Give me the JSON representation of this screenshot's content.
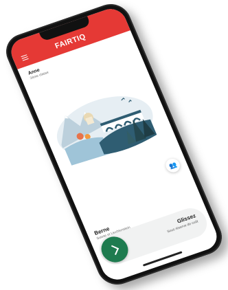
{
  "header": {
    "logo": "FAIRTIQ",
    "menu_icon": "hamburger-menu-icon",
    "background": "#e53935"
  },
  "passenger": {
    "name": "Anne",
    "travel_class": "2ème classe"
  },
  "people_button": {
    "icon": "people-icon"
  },
  "station": {
    "name": "Berne",
    "zone": "Suisse et Liechtenstein"
  },
  "swipe": {
    "title": "Glissez",
    "subtitle": "Sous réserve de coût",
    "button_color": "#1e7b4f",
    "button_icon": "chevron-right-icon"
  }
}
